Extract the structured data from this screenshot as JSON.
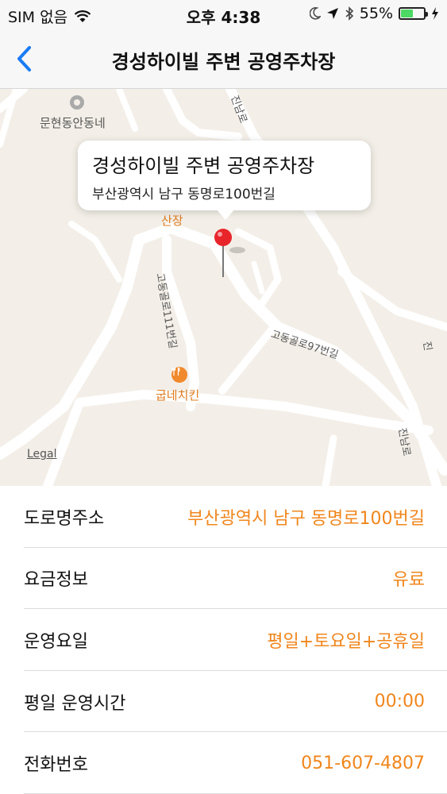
{
  "status_bar": {
    "carrier": "SIM 없음",
    "time": "오후 4:38",
    "battery_percent": "55%",
    "battery_level": 0.55,
    "icons": [
      "wifi-icon",
      "moon-icon",
      "location-arrow-icon",
      "bluetooth-icon",
      "battery-icon",
      "charging-icon"
    ]
  },
  "nav": {
    "title": "경성하이빌 주변 공영주차장",
    "back_icon": "chevron-left-icon"
  },
  "map": {
    "callout_title": "경성하이빌 주변 공영주차장",
    "callout_address": "부산광역시 남구 동명로100번길",
    "labels": {
      "munhyeon": "문현동안동네",
      "sanjang": "산장",
      "restaurant": "굽네치킨",
      "street_a": "고동골로111번길",
      "street_b": "고동골로97번길",
      "street_c": "진남로",
      "street_d": "진남로",
      "street_e": "진"
    },
    "legal": "Legal",
    "colors": {
      "road": "#ffffff",
      "background": "#f3efe8",
      "poi": "#e07b1f",
      "pin": "#e8252b"
    }
  },
  "info": {
    "rows": [
      {
        "label": "도로명주소",
        "value": "부산광역시 남구 동명로100번길"
      },
      {
        "label": "요금정보",
        "value": "유료"
      },
      {
        "label": "운영요일",
        "value": "평일+토요일+공휴일"
      },
      {
        "label": "평일 운영시간",
        "value": "00:00"
      },
      {
        "label": "전화번호",
        "value": "051-607-4807"
      }
    ],
    "accent_color": "#f0861c"
  }
}
